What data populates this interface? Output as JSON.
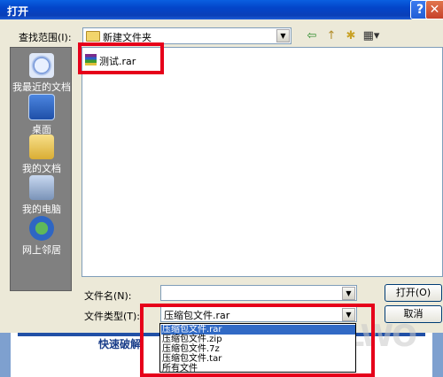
{
  "window": {
    "title": "打开",
    "help": "?",
    "close": "✕"
  },
  "lookin": {
    "label": "查找范围(I):",
    "value": "新建文件夹"
  },
  "toolbar": {
    "back": "⇦",
    "up": "↑",
    "newfolder": "✱",
    "view": "▦▾"
  },
  "places": [
    {
      "label": "我最近的文档",
      "icon": "recent-documents-icon"
    },
    {
      "label": "桌面",
      "icon": "desktop-icon"
    },
    {
      "label": "我的文档",
      "icon": "my-documents-icon"
    },
    {
      "label": "我的电脑",
      "icon": "my-computer-icon"
    },
    {
      "label": "网上邻居",
      "icon": "network-places-icon"
    }
  ],
  "files": [
    {
      "name": "测试.rar"
    }
  ],
  "filename": {
    "label": "文件名(N):",
    "value": ""
  },
  "filetype": {
    "label": "文件类型(T):",
    "value": "压缩包文件.rar",
    "options": [
      "压缩包文件.rar",
      "压缩包文件.zip",
      "压缩包文件.7z",
      "压缩包文件.tar",
      "所有文件"
    ]
  },
  "buttons": {
    "open": "打开(O)",
    "cancel": "取消"
  },
  "background": {
    "text": "快速破解"
  },
  "watermark": "3LWO"
}
